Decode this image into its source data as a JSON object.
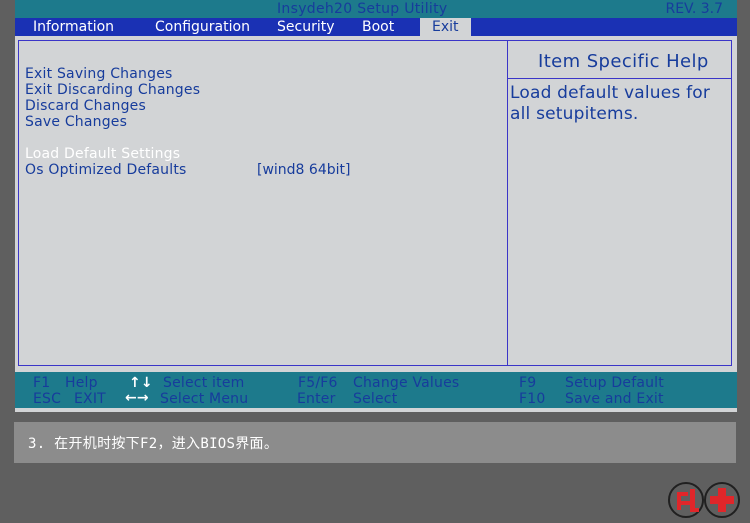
{
  "window": {
    "title": "Insydeh20  Setup  Utility",
    "revision": "REV. 3.7"
  },
  "menu": {
    "tabs": [
      {
        "label": "Information"
      },
      {
        "label": "Configuration"
      },
      {
        "label": "Security"
      },
      {
        "label": "Boot"
      },
      {
        "label": "Exit",
        "active": true
      }
    ]
  },
  "main": {
    "options": [
      {
        "label": "Exit Saving Changes"
      },
      {
        "label": "Exit Discarding Changes"
      },
      {
        "label": "Discard Changes"
      },
      {
        "label": "Save Changes"
      },
      {
        "label": "Load Default Settings",
        "selected": true
      },
      {
        "label": "Os Optimized Defaults",
        "value": "[wind8 64bit]"
      }
    ]
  },
  "help": {
    "title": "Item Specific  Help",
    "text": "Load default values for all setupitems."
  },
  "footer": {
    "keys": [
      {
        "key": "F1",
        "label": "Help"
      },
      {
        "key": "ESC",
        "label": "EXIT"
      },
      {
        "key": "↑↓",
        "label": "Select item"
      },
      {
        "key": "←→",
        "label": "Select Menu"
      },
      {
        "key": "F5/F6",
        "label": "Change Values"
      },
      {
        "key": "Enter",
        "label": "Select"
      },
      {
        "key": "F9",
        "label": "Setup Default"
      },
      {
        "key": "F10",
        "label": "Save and Exit"
      }
    ]
  },
  "caption": {
    "text": "3. 在开机时按下F2，进入BIOS界面。"
  },
  "colors": {
    "header_teal": "#1d7a8c",
    "menu_blue": "#1a31b4",
    "panel_gray": "#d2d4d6",
    "text_blue": "#173c9c",
    "logo_red": "#e0262a"
  },
  "icons": {
    "logo": "red-circular-brand-logo"
  }
}
